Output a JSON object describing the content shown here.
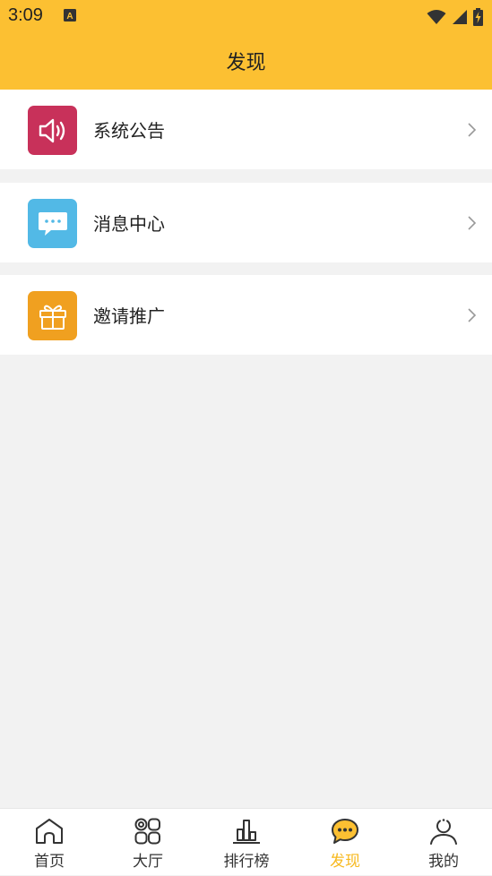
{
  "status_bar": {
    "time": "3:09",
    "notification_icon": "a-box-icon",
    "icons": [
      "wifi-icon",
      "signal-icon",
      "battery-charging-icon"
    ]
  },
  "app_bar": {
    "title": "发现"
  },
  "list": {
    "items": [
      {
        "label": "系统公告",
        "icon": "speaker-icon",
        "color": "#c8315a"
      },
      {
        "label": "消息中心",
        "icon": "chat-bubble-icon",
        "color": "#52b9e6"
      },
      {
        "label": "邀请推广",
        "icon": "gift-icon",
        "color": "#f0a020"
      }
    ]
  },
  "tab_bar": {
    "active_index": 3,
    "active_color": "#f7b91f",
    "tabs": [
      {
        "label": "首页",
        "icon": "home-icon"
      },
      {
        "label": "大厅",
        "icon": "grid-icon"
      },
      {
        "label": "排行榜",
        "icon": "ranking-icon"
      },
      {
        "label": "发现",
        "icon": "discover-chat-icon"
      },
      {
        "label": "我的",
        "icon": "profile-icon"
      }
    ]
  },
  "colors": {
    "header": "#fcc032",
    "background": "#f2f2f2"
  }
}
